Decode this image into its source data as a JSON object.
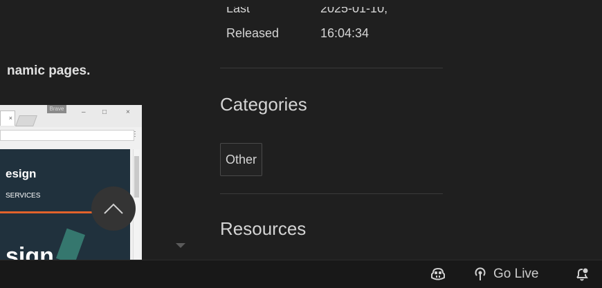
{
  "readme": {
    "paragraph_fragment": "namic pages."
  },
  "screenshot": {
    "tab_close": "×",
    "window_badge": "Brave",
    "min_glyph": "–",
    "max_glyph": "□",
    "close_glyph": "×",
    "menu_glyph": "⋮",
    "site_title": "esign",
    "site_subtitle": "SERVICES",
    "site_hero": "sign"
  },
  "details": {
    "last_released_label_line1": "Last",
    "last_released_label_line2": "Released",
    "last_released_value_line1": "2025-01-10,",
    "last_released_value_line2": "16:04:34"
  },
  "categories": {
    "heading": "Categories",
    "items": [
      "Other"
    ]
  },
  "resources": {
    "heading": "Resources"
  },
  "statusbar": {
    "copilot_icon": "copilot-icon",
    "go_live_label": "Go Live",
    "broadcast_icon": "broadcast-icon",
    "notification_icon": "bell-dot-icon"
  }
}
